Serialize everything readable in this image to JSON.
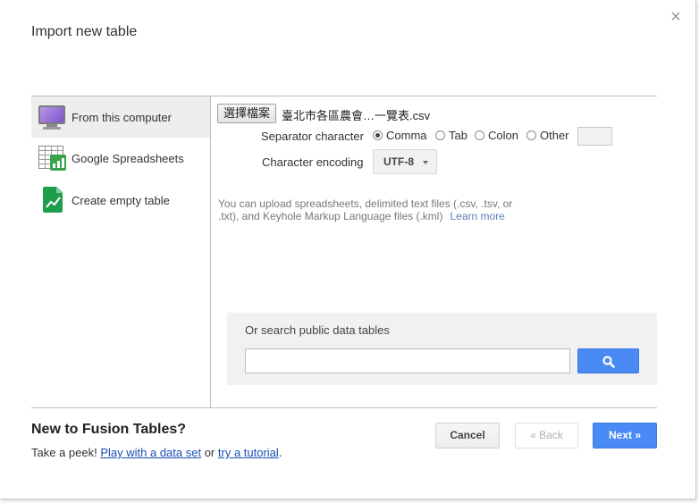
{
  "dialog": {
    "title": "Import new table",
    "close_glyph": "×"
  },
  "sources": [
    {
      "label": "From this computer",
      "icon": "monitor-icon",
      "active": true
    },
    {
      "label": "Google Spreadsheets",
      "icon": "spreadsheet-icon",
      "active": false
    },
    {
      "label": "Create empty table",
      "icon": "empty-table-icon",
      "active": false
    }
  ],
  "upload": {
    "file_button": "選擇檔案",
    "file_name": "臺北市各區農會…一覽表.csv",
    "separator_label": "Separator character",
    "separators": [
      {
        "label": "Comma",
        "checked": true
      },
      {
        "label": "Tab",
        "checked": false
      },
      {
        "label": "Colon",
        "checked": false
      },
      {
        "label": "Other",
        "checked": false
      }
    ],
    "other_value": "",
    "encoding_label": "Character encoding",
    "encoding_value": "UTF-8",
    "help_text": "You can upload spreadsheets, delimited text files (.csv, .tsv, or .txt), and Keyhole Markup Language files (.kml)",
    "learn_more": "Learn more"
  },
  "search": {
    "title": "Or search public data tables",
    "value": "",
    "placeholder": ""
  },
  "footer": {
    "title": "New to Fusion Tables?",
    "peek": "Take a peek!",
    "play_link": "Play with a data set",
    "or": "or",
    "tutorial_link": "try a tutorial",
    "period": "."
  },
  "buttons": {
    "cancel": "Cancel",
    "back": "« Back",
    "next": "Next »"
  },
  "colors": {
    "primary": "#4a8af4",
    "link": "#1a4fb5",
    "active_bg": "#eeeeee"
  }
}
